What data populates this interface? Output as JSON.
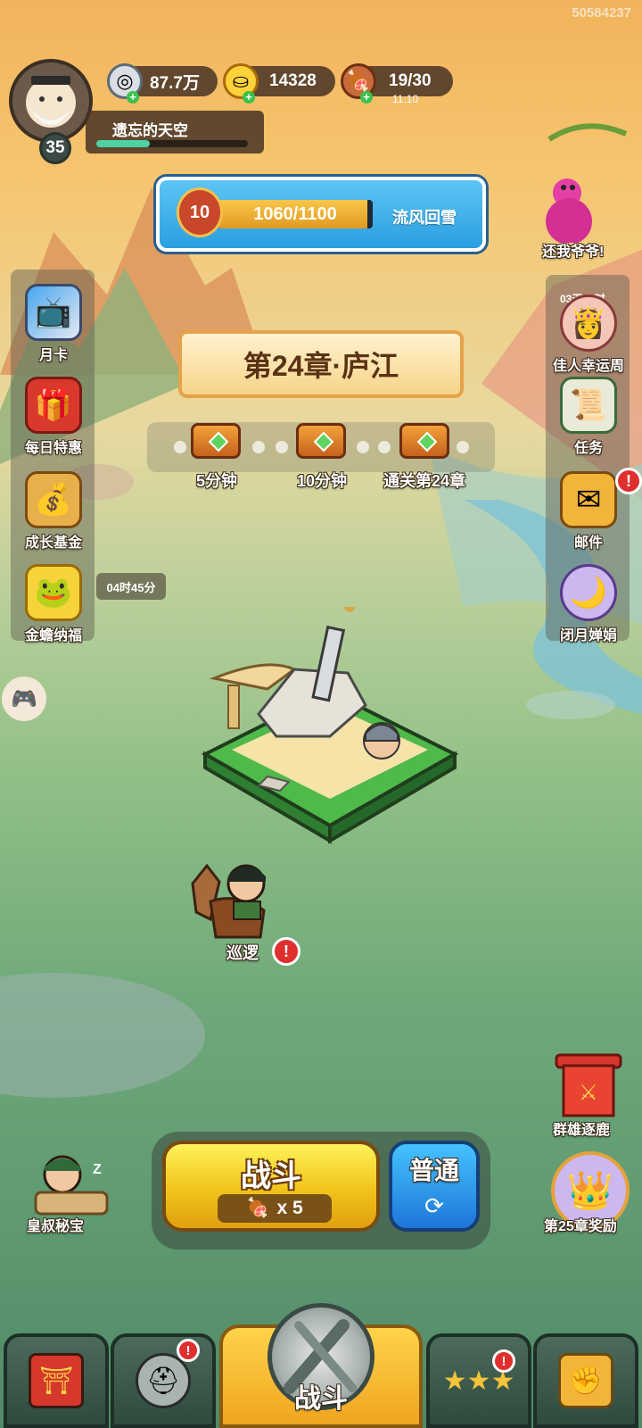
{
  "session_id": "50584237",
  "player": {
    "level": "35",
    "name": "遗忘的天空",
    "exp_fraction": 0.35
  },
  "resources": {
    "silver": "87.7万",
    "gold": "14328",
    "stamina": "19/30",
    "stamina_timer": "11:10"
  },
  "stage": {
    "level": "10",
    "progress": "1060/1100",
    "progress_fraction": 0.9636,
    "name": "流风回雪"
  },
  "event_top_right": {
    "label": "还我爷爷!"
  },
  "chapter": {
    "title": "第24章·庐江"
  },
  "chests": [
    {
      "label": "5分钟"
    },
    {
      "label": "10分钟"
    },
    {
      "label": "通关第24章"
    }
  ],
  "left_menu": [
    {
      "label": "月卡",
      "icon": "month-card-icon"
    },
    {
      "label": "每日特惠",
      "icon": "gift-bag-icon"
    },
    {
      "label": "成长基金",
      "icon": "growth-fund-icon"
    },
    {
      "label": "金蟾纳福",
      "icon": "golden-toad-icon",
      "timer": "04时45分"
    }
  ],
  "right_menu": [
    {
      "label": "佳人幸运周",
      "icon": "beauty-icon",
      "timer": "03天07时"
    },
    {
      "label": "任务",
      "icon": "scroll-icon"
    },
    {
      "label": "邮件",
      "icon": "mail-icon",
      "badge": "!"
    },
    {
      "label": "闭月婵娟",
      "icon": "moon-icon"
    }
  ],
  "patrol": {
    "label": "巡逻",
    "badge": "!"
  },
  "heroes_chase": {
    "label": "群雄逐鹿"
  },
  "chapter_reward": {
    "label": "第25章奖励"
  },
  "uncle_treasure": {
    "label": "皇叔秘宝",
    "sleep": "Z"
  },
  "battle": {
    "label": "战斗",
    "cost": "x 5",
    "mode": "普通",
    "mode_refresh_glyph": "⟳"
  },
  "bottom_nav": {
    "center_label": "战斗",
    "badges": [
      "!",
      "!"
    ]
  },
  "colors": {
    "accent_yellow": "#f1c31a",
    "accent_blue": "#1d76d8",
    "badge_red": "#e02f2f"
  }
}
